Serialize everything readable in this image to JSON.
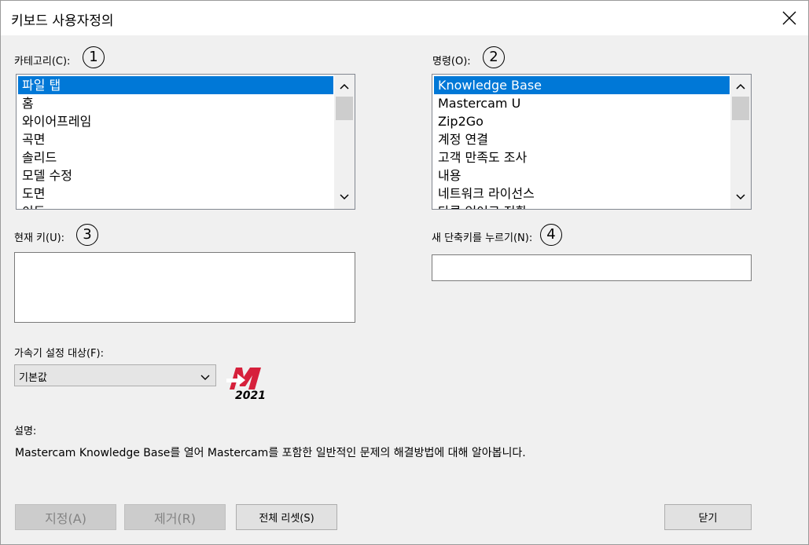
{
  "window": {
    "title": "키보드 사용자정의"
  },
  "category": {
    "label": "카테고리(C):",
    "badge": "1",
    "items": [
      "파일 탭",
      "홈",
      "와이어프레임",
      "곡면",
      "솔리드",
      "모델 수정",
      "도면",
      "이동"
    ],
    "selected_index": 0
  },
  "command": {
    "label": "명령(O):",
    "badge": "2",
    "items": [
      "Knowledge Base",
      "Mastercam U",
      "Zip2Go",
      "계정 연결",
      "고객 만족도 조사",
      "내용",
      "네트워크 라이선스",
      "다른 언어로 전환"
    ],
    "selected_index": 0
  },
  "current_key": {
    "label": "현재 키(U):",
    "badge": "3",
    "value": ""
  },
  "new_shortcut": {
    "label": "새 단축키를 누르기(N):",
    "badge": "4",
    "value": ""
  },
  "accelerator": {
    "label": "가속기 설정 대상(F):",
    "selected": "기본값"
  },
  "logo": {
    "year": "2021",
    "brand_color": "#d6203b"
  },
  "description": {
    "label": "설명:",
    "text": "Mastercam Knowledge Base를 열어 Mastercam를 포함한 일반적인 문제의 해결방법에 대해 알아봅니다."
  },
  "buttons": {
    "assign": "지정(A)",
    "remove": "제거(R)",
    "reset_all": "전체 리셋(S)",
    "close": "닫기"
  },
  "colors": {
    "selection": "#0078d7",
    "dialog_bg": "#f0f0f0"
  }
}
